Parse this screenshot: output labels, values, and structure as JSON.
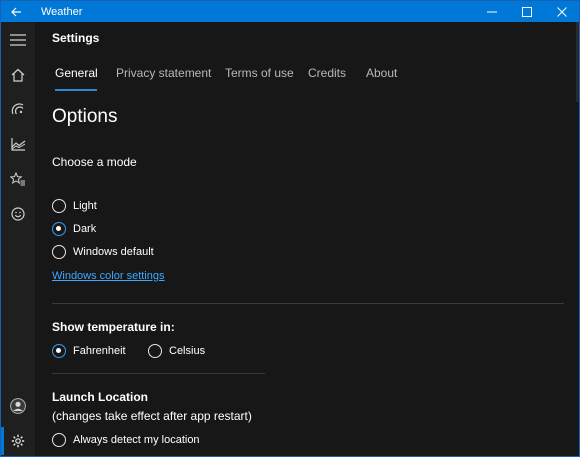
{
  "window": {
    "title": "Weather",
    "accent_color": "#0078d7",
    "controls": [
      "minimize-icon",
      "maximize-icon",
      "close-icon"
    ]
  },
  "rail": {
    "items": [
      {
        "icon": "hamburger-menu-icon"
      },
      {
        "icon": "home-icon"
      },
      {
        "icon": "maps-icon"
      },
      {
        "icon": "historical-weather-icon"
      },
      {
        "icon": "favorites-icon"
      },
      {
        "icon": "feedback-smiley-icon"
      },
      {
        "icon": "account-icon"
      },
      {
        "icon": "settings-gear-icon",
        "selected": true
      }
    ]
  },
  "settings": {
    "title": "Settings",
    "tabs": [
      {
        "label": "General",
        "active": true
      },
      {
        "label": "Privacy statement"
      },
      {
        "label": "Terms of use"
      },
      {
        "label": "Credits"
      },
      {
        "label": "About"
      }
    ],
    "options_heading": "Options",
    "mode": {
      "label": "Choose a mode",
      "choices": [
        {
          "label": "Light",
          "checked": false
        },
        {
          "label": "Dark",
          "checked": true
        },
        {
          "label": "Windows default",
          "checked": false
        }
      ],
      "color_settings_link": "Windows color settings"
    },
    "temperature": {
      "label": "Show temperature in:",
      "choices": [
        {
          "label": "Fahrenheit",
          "checked": true
        },
        {
          "label": "Celsius",
          "checked": false
        }
      ]
    },
    "launch_location": {
      "label": "Launch Location",
      "note": "(changes take effect after app restart)",
      "choices": [
        {
          "label": "Always detect my location",
          "checked": false
        }
      ]
    }
  }
}
